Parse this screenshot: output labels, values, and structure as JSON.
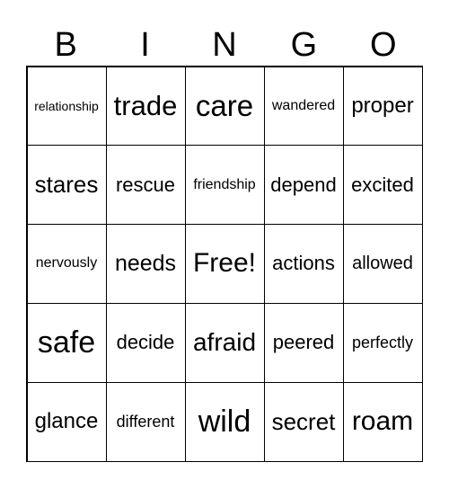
{
  "header": [
    "B",
    "I",
    "N",
    "G",
    "O"
  ],
  "cells": [
    [
      "relationship",
      "trade",
      "care",
      "wandered",
      "proper"
    ],
    [
      "stares",
      "rescue",
      "friendship",
      "depend",
      "excited"
    ],
    [
      "nervously",
      "needs",
      "Free!",
      "actions",
      "allowed"
    ],
    [
      "safe",
      "decide",
      "afraid",
      "peered",
      "perfectly"
    ],
    [
      "glance",
      "different",
      "wild",
      "secret",
      "roam"
    ]
  ]
}
